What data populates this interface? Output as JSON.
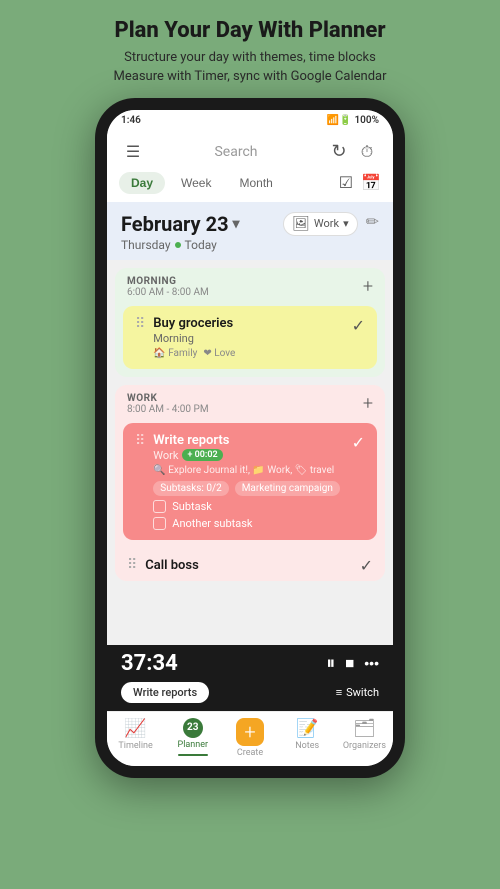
{
  "header": {
    "title": "Plan Your Day With Planner",
    "subtitle_line1": "Structure your day with themes, time blocks",
    "subtitle_line2": "Measure with Timer, sync with Google Calendar"
  },
  "status_bar": {
    "time": "1:46",
    "battery": "100%",
    "icons": "🔊🔧📶"
  },
  "top_nav": {
    "menu_icon": "☰",
    "search_placeholder": "Search",
    "refresh_icon": "↻",
    "timer_icon": "⏱"
  },
  "view_tabs": {
    "tabs": [
      "Day",
      "Week",
      "Month"
    ],
    "active": "Day",
    "right_icons": [
      "✓□",
      "📅"
    ]
  },
  "date_header": {
    "date": "February 23",
    "arrow": "▾",
    "day": "Thursday",
    "today_label": "Today",
    "work_label": "Work",
    "edit_icon": "✏"
  },
  "morning_section": {
    "label": "MORNING",
    "time_range": "6:00 AM - 8:00 AM",
    "add_icon": "+",
    "task": {
      "name": "Buy groceries",
      "context": "Morning",
      "tags": [
        "Family",
        "Love"
      ],
      "tag_icons": [
        "🏠",
        "❤"
      ]
    }
  },
  "work_section": {
    "label": "WORK",
    "time_range": "8:00 AM - 4:00 PM",
    "add_icon": "+",
    "task": {
      "name": "Write reports",
      "context": "Work",
      "time_plus": "+ 00:02",
      "tags_line": "🔍 Explore Journal it!,  Work,  travel",
      "subtasks_label": "Subtasks: 0/2",
      "campaign_label": "Marketing campaign",
      "subtask1": "Subtask",
      "subtask2": "Another subtask"
    }
  },
  "call_boss": {
    "name": "Call boss"
  },
  "timer": {
    "display": "37:34",
    "pause_icon": "⏸",
    "stop_icon": "⏹",
    "more_icon": "•••",
    "task_label": "Write reports",
    "switch_label": "Switch",
    "switch_icon": "≡"
  },
  "bottom_nav": {
    "items": [
      {
        "icon": "📈",
        "label": "Timeline",
        "active": false
      },
      {
        "icon": "23",
        "label": "Planner",
        "active": true
      },
      {
        "icon": "+",
        "label": "Create",
        "active": false
      },
      {
        "icon": "📝",
        "label": "Notes",
        "active": false
      },
      {
        "icon": "🗂",
        "label": "Organizers",
        "active": false
      }
    ]
  },
  "colors": {
    "bg": "#7aab7a",
    "phone_bg": "#1a1a1a",
    "screen_bg": "#f5f5f5",
    "active_tab": "#e8f0e8",
    "active_color": "#3a7a3a",
    "date_bg": "#e8eef8",
    "morning_bg": "#e8f5e8",
    "task_yellow": "#f5f5a0",
    "work_bg": "#fde8e8",
    "task_red": "#f78a8a",
    "timer_bg": "#1a1a1a",
    "create_orange": "#f5a623"
  }
}
